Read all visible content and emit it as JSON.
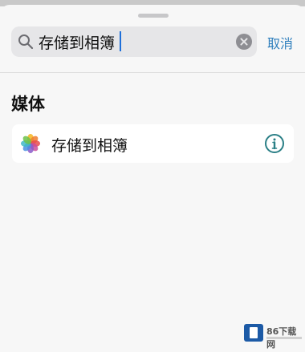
{
  "search": {
    "value": "存储到相簿",
    "cancel_label": "取消"
  },
  "section": {
    "title": "媒体"
  },
  "results": [
    {
      "label": "存储到相簿",
      "icon": "photos-icon",
      "trailing_icon": "info-icon"
    }
  ],
  "watermark": {
    "text": "86下载网"
  },
  "colors": {
    "accent": "#2f7fbd",
    "background": "#f7f7f7",
    "card": "#ffffff"
  }
}
